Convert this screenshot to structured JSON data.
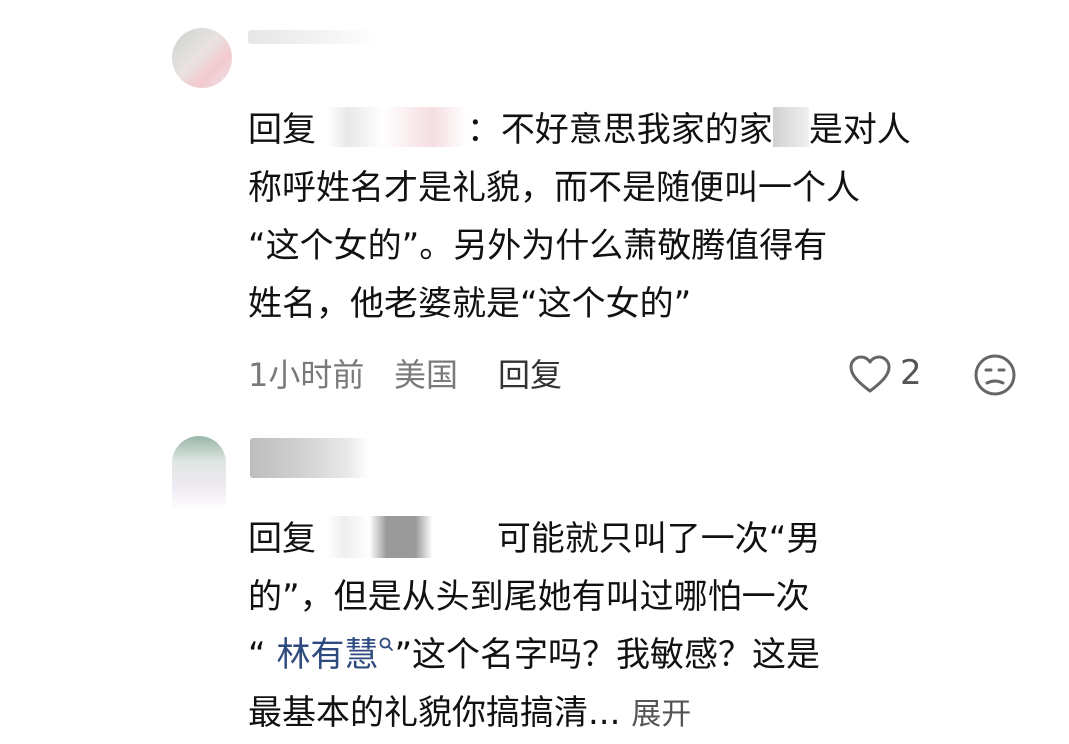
{
  "comment1": {
    "reply_prefix": "回复",
    "colon": "：",
    "line1_before": "不好意思我家的家",
    "line1_after": "是对人",
    "line2": "称呼姓名才是礼貌，而不是随便叫一个人",
    "line3": "“这个女的”。另外为什么萧敬腾值得有",
    "line4": "姓名，他老婆就是“这个女的”",
    "time": "1小时前",
    "location": "美国",
    "reply_button": "回复",
    "like_count": "2"
  },
  "comment2": {
    "reply_prefix": "回复",
    "line1": "可能就只叫了一次“男",
    "line2": "的”，但是从头到尾她有叫过哪怕一次",
    "quote_open": "“",
    "link_text": "林有慧",
    "quote_close": "”这个名字吗？我敏感？这是",
    "line4": "最基本的礼貌你搞搞清...",
    "expand": "展开"
  },
  "icons": {
    "like": "heart-outline-icon",
    "dislike": "unhappy-face-icon",
    "link": "search-icon"
  },
  "colors": {
    "text": "#111111",
    "meta": "#7a7a7a",
    "link": "#2f4a7f"
  }
}
